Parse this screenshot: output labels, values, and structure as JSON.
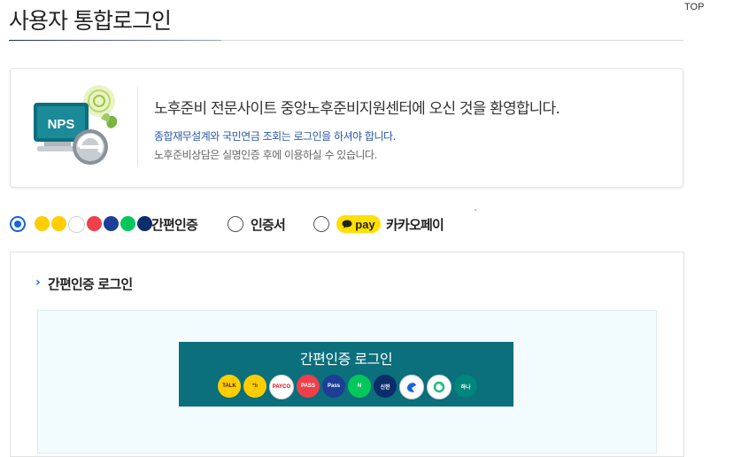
{
  "page": {
    "title": "사용자 통합로그인",
    "top_link": "TOP"
  },
  "welcome": {
    "logo_text": "NPS",
    "heading": "노후준비 전문사이트 중앙노후준비지원센터에 오신 것을 환영합니다.",
    "line1": "종합재무설계와 국민연금 조회는 로그인을 하셔야 합니다.",
    "line2": "노후준비상담은 실명인증 후에 이용하실 수 있습니다."
  },
  "login_options": [
    {
      "label": "간편인증",
      "selected": true
    },
    {
      "label": "인증서",
      "selected": false
    },
    {
      "label": "카카오페이",
      "selected": false
    }
  ],
  "kakaopay_badge": "pay",
  "tiny_mark": "`",
  "mini_icons": [
    {
      "name": "kakao-talk-icon",
      "bg": "#ffcd00",
      "fg": "#3a1d1d",
      "text": ""
    },
    {
      "name": "kb-icon",
      "bg": "#ffcd00",
      "fg": "#5a4a00",
      "text": ""
    },
    {
      "name": "payco-icon",
      "bg": "#ffffff",
      "fg": "#e60012",
      "text": ""
    },
    {
      "name": "pass-icon",
      "bg": "#ef3f4a",
      "fg": "#ffffff",
      "text": ""
    },
    {
      "name": "samsung-pass-icon",
      "bg": "#1d3e96",
      "fg": "#ffffff",
      "text": ""
    },
    {
      "name": "naver-icon",
      "bg": "#03c75a",
      "fg": "#ffffff",
      "text": ""
    },
    {
      "name": "shinhan-icon",
      "bg": "#0c2d6b",
      "fg": "#ffffff",
      "text": ""
    }
  ],
  "section": {
    "title": "간편인증 로그인"
  },
  "login_button": {
    "label": "간편인증 로그인"
  },
  "providers": [
    {
      "name": "kakao-talk-icon",
      "bg": "#ffcd00",
      "fg": "#3a1d1d",
      "text": "TALK"
    },
    {
      "name": "kb-icon",
      "bg": "#ffcd00",
      "fg": "#5a4a00",
      "text": "*b"
    },
    {
      "name": "payco-icon",
      "bg": "#ffffff",
      "fg": "#e60012",
      "text": "PAYCO"
    },
    {
      "name": "pass-icon",
      "bg": "#ef3f4a",
      "fg": "#ffffff",
      "text": "PASS"
    },
    {
      "name": "samsung-pass-icon",
      "bg": "#1d3e96",
      "fg": "#ffffff",
      "text": "Pass"
    },
    {
      "name": "naver-icon",
      "bg": "#03c75a",
      "fg": "#ffffff",
      "text": "N"
    },
    {
      "name": "shinhan-icon",
      "bg": "#0c2d6b",
      "fg": "#ffffff",
      "text": "신한"
    },
    {
      "name": "toss-icon",
      "bg": "#ffffff",
      "fg": "#1b64da",
      "text": ""
    },
    {
      "name": "ok-icon",
      "bg": "#ffffff",
      "fg": "#1fbf7a",
      "text": ""
    },
    {
      "name": "hana-icon",
      "bg": "#00867a",
      "fg": "#ffffff",
      "text": "하나"
    }
  ],
  "colors": {
    "accent": "#1a66d8",
    "login_button_bg": "#0b6f7c",
    "light_area_bg": "#f2fbfd",
    "kakaopay_yellow": "#ffe000"
  }
}
